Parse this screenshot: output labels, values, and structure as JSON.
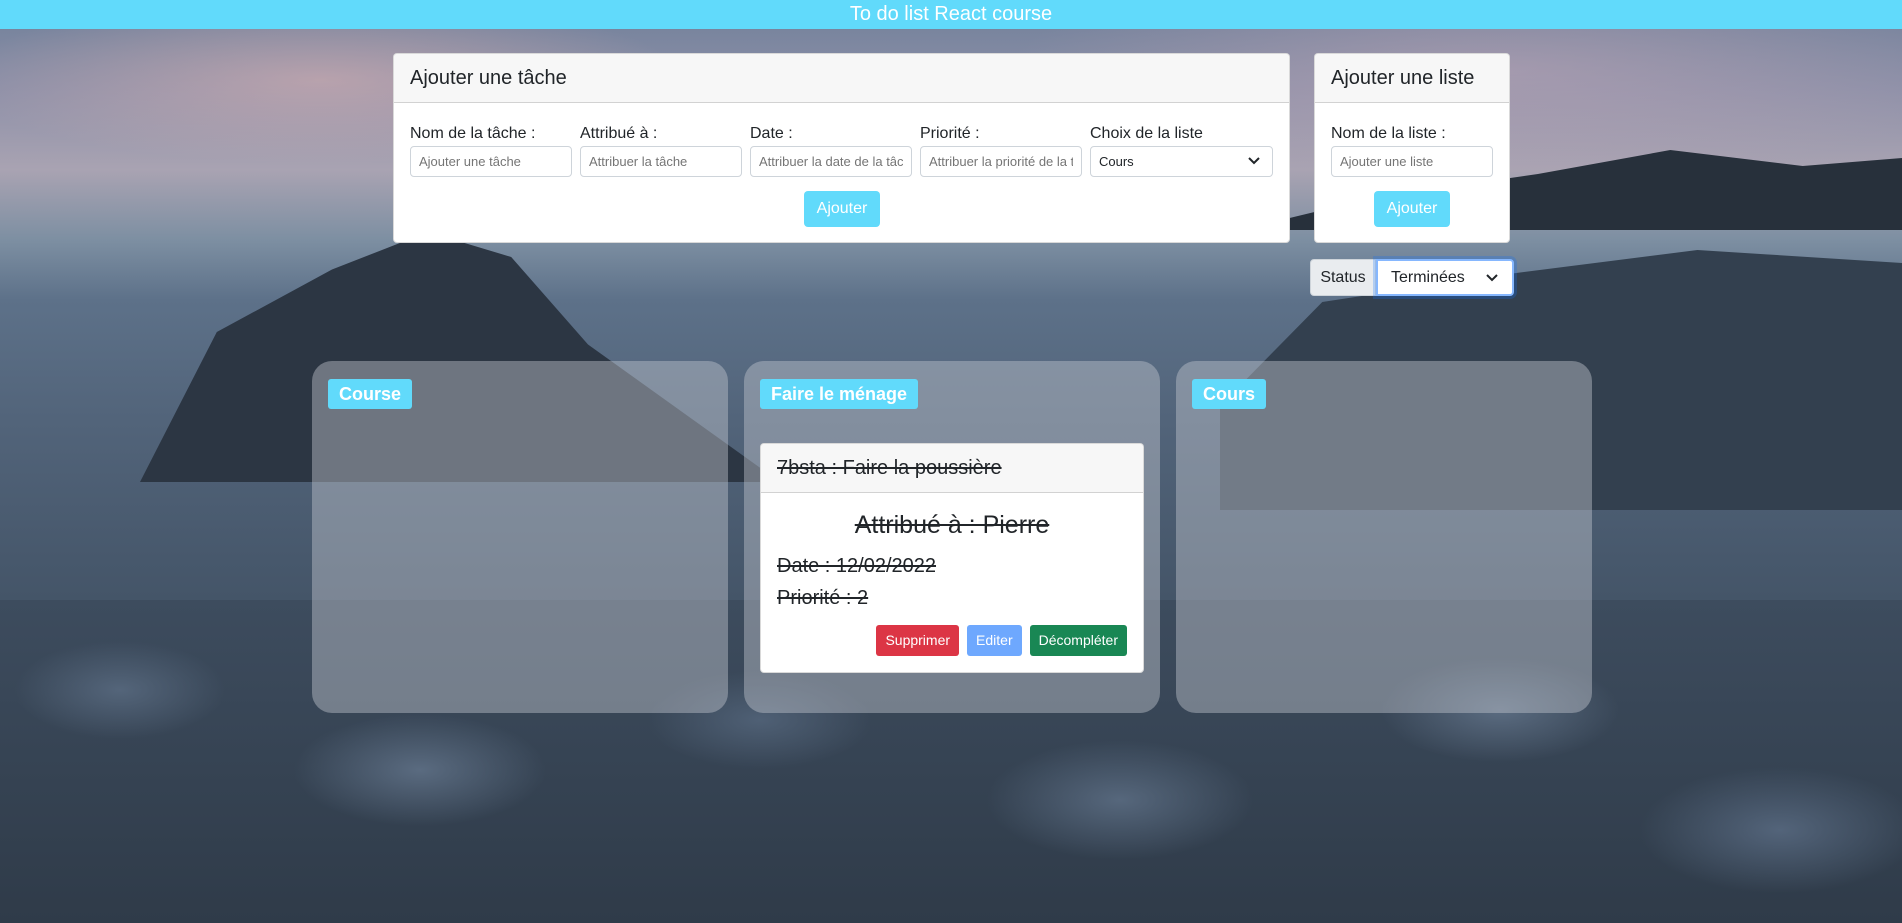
{
  "app": {
    "title": "To do list React course"
  },
  "addTask": {
    "header": "Ajouter une tâche",
    "fields": [
      {
        "label": "Nom de la tâche :",
        "placeholder": "Ajouter une tâche"
      },
      {
        "label": "Attribué à :",
        "placeholder": "Attribuer la tâche"
      },
      {
        "label": "Date :",
        "placeholder": "Attribuer la date de la tâche"
      },
      {
        "label": "Priorité :",
        "placeholder": "Attribuer la priorité de la tâche"
      }
    ],
    "listSelect": {
      "label": "Choix de la liste",
      "value": "Cours"
    },
    "button": "Ajouter"
  },
  "addList": {
    "header": "Ajouter une liste",
    "field": {
      "label": "Nom de la liste :",
      "placeholder": "Ajouter une liste"
    },
    "button": "Ajouter"
  },
  "statusFilter": {
    "label": "Status",
    "value": "Terminées"
  },
  "lists": [
    {
      "name": "Course",
      "tasks": []
    },
    {
      "name": "Faire le ménage",
      "tasks": [
        {
          "title": "7bsta : Faire la poussière",
          "assigned": "Attribué à : Pierre",
          "date": "Date : 12/02/2022",
          "priority": "Priorité : 2",
          "actions": {
            "delete": "Supprimer",
            "edit": "Editer",
            "uncomplete": "Décompléter"
          }
        }
      ]
    },
    {
      "name": "Cours",
      "tasks": []
    }
  ],
  "colors": {
    "accent": "#61dafb",
    "danger": "#dc3545",
    "edit": "#6ea8fe",
    "success": "#198754"
  }
}
